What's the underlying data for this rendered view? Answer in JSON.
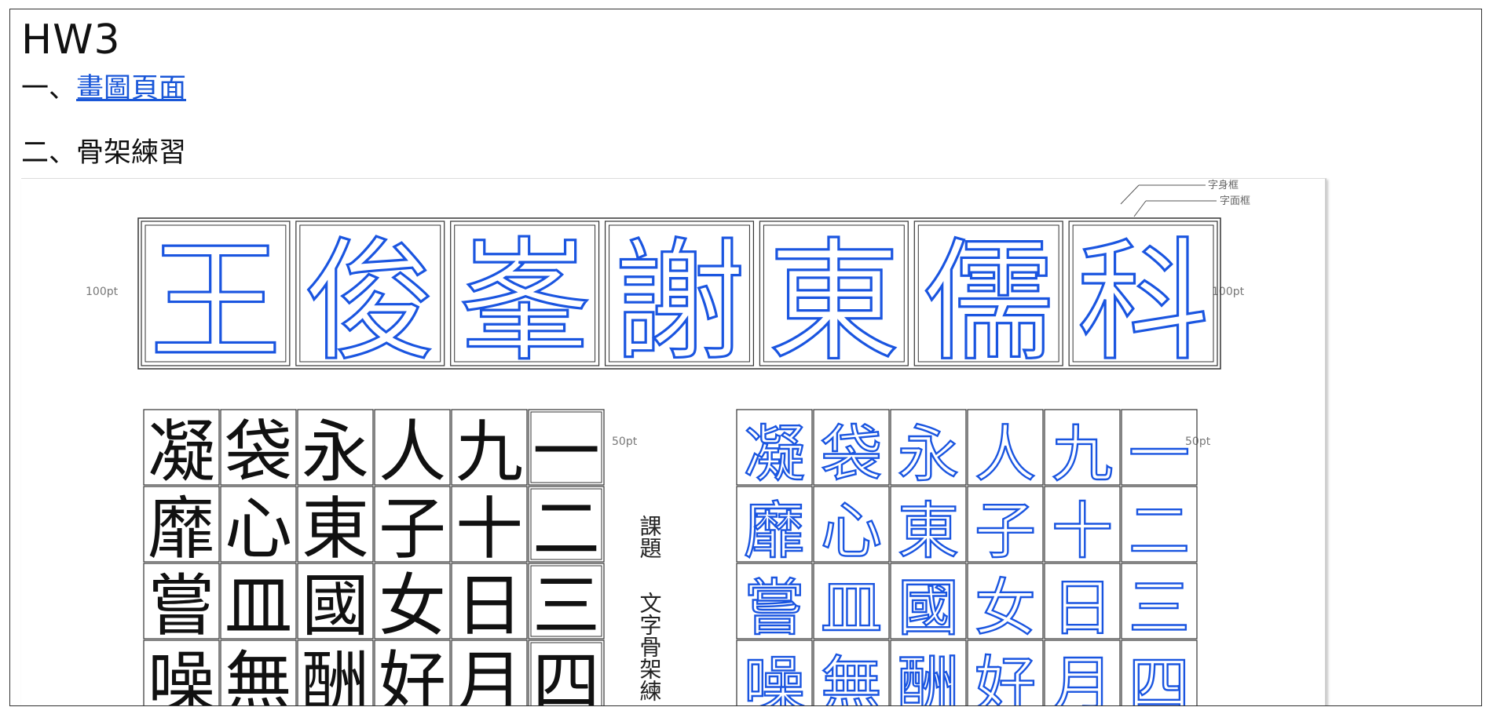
{
  "page": {
    "title": "HW3",
    "sections": [
      {
        "prefix": "一、",
        "link_text": "畫圖頁面"
      },
      {
        "prefix": "二、",
        "text": "骨架練習"
      }
    ]
  },
  "worksheet": {
    "legend_outer": "字身框",
    "legend_inner": "字面框",
    "label_100_left": "100pt",
    "label_100_right": "100pt",
    "label_50_left": "50pt",
    "label_50_right": "50pt",
    "side_title_1": "課題",
    "side_title_2": "文字骨架練",
    "name_chars": [
      "王",
      "俊",
      "峯",
      "謝",
      "東",
      "儒",
      "科"
    ],
    "grid_rows": [
      [
        "凝",
        "袋",
        "永",
        "人",
        "九",
        "一"
      ],
      [
        "靡",
        "心",
        "東",
        "子",
        "十",
        "二"
      ],
      [
        "嘗",
        "皿",
        "國",
        "女",
        "日",
        "三"
      ],
      [
        "噪",
        "無",
        "酬",
        "好",
        "月",
        "四"
      ]
    ],
    "colors": {
      "ink": "#1a55e0",
      "grid": "#333333",
      "label": "#777777"
    }
  }
}
